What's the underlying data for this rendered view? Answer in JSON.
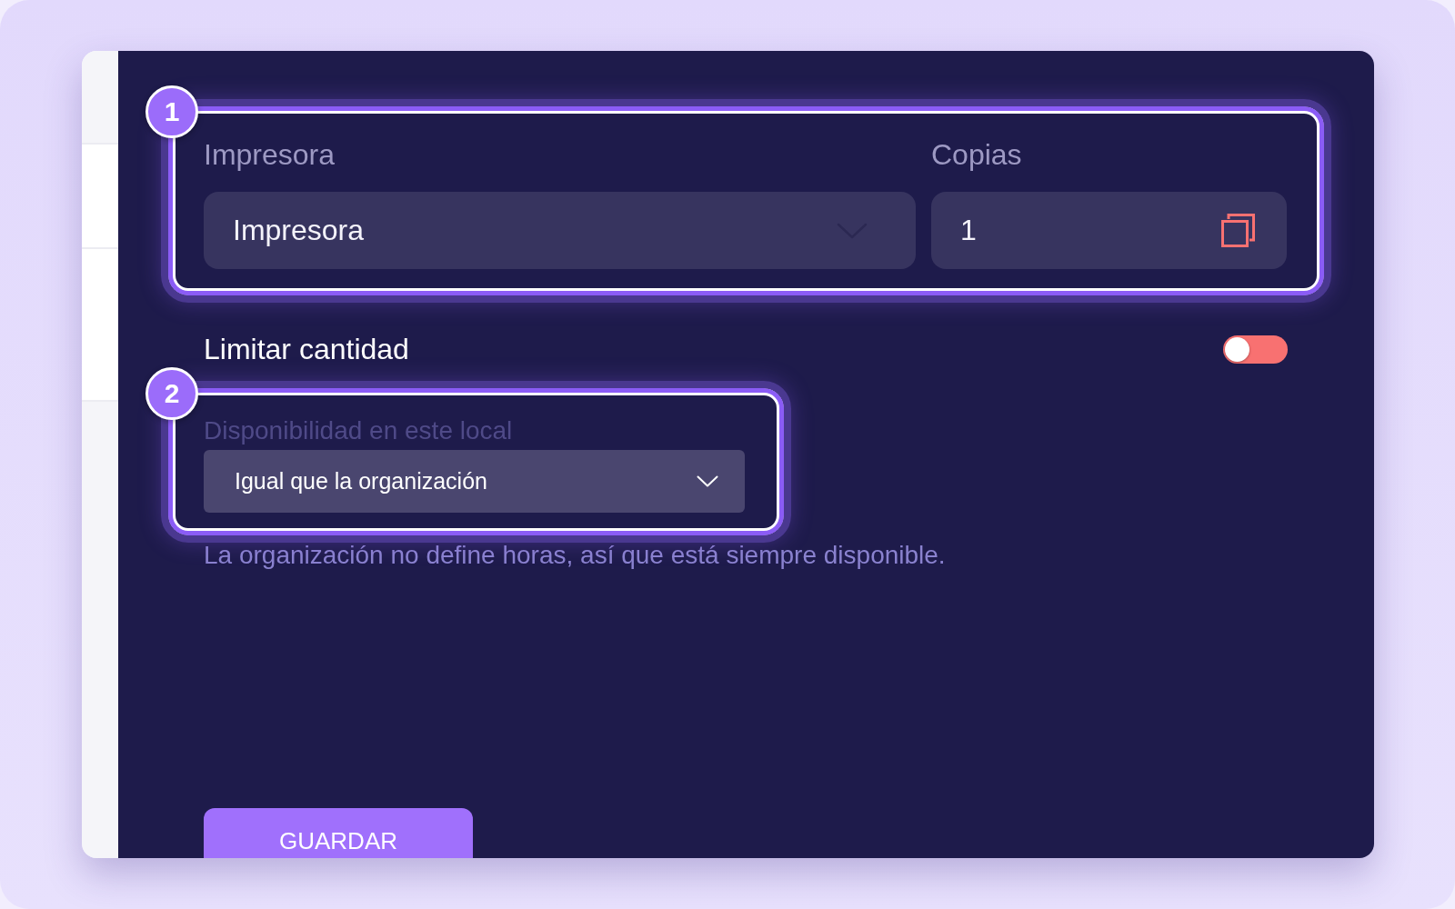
{
  "printer_section": {
    "badge": "1",
    "printer": {
      "label": "Impresora",
      "value": "Impresora"
    },
    "copies": {
      "label": "Copias",
      "value": "1"
    }
  },
  "limit_quantity": {
    "label": "Limitar cantidad",
    "on": false
  },
  "availability_section": {
    "badge": "2",
    "label": "Disponibilidad en este local",
    "value": "Igual que la organización",
    "help_text": "La organización no define horas, así que está siempre disponible."
  },
  "save_button": {
    "label": "GUARDAR"
  }
}
